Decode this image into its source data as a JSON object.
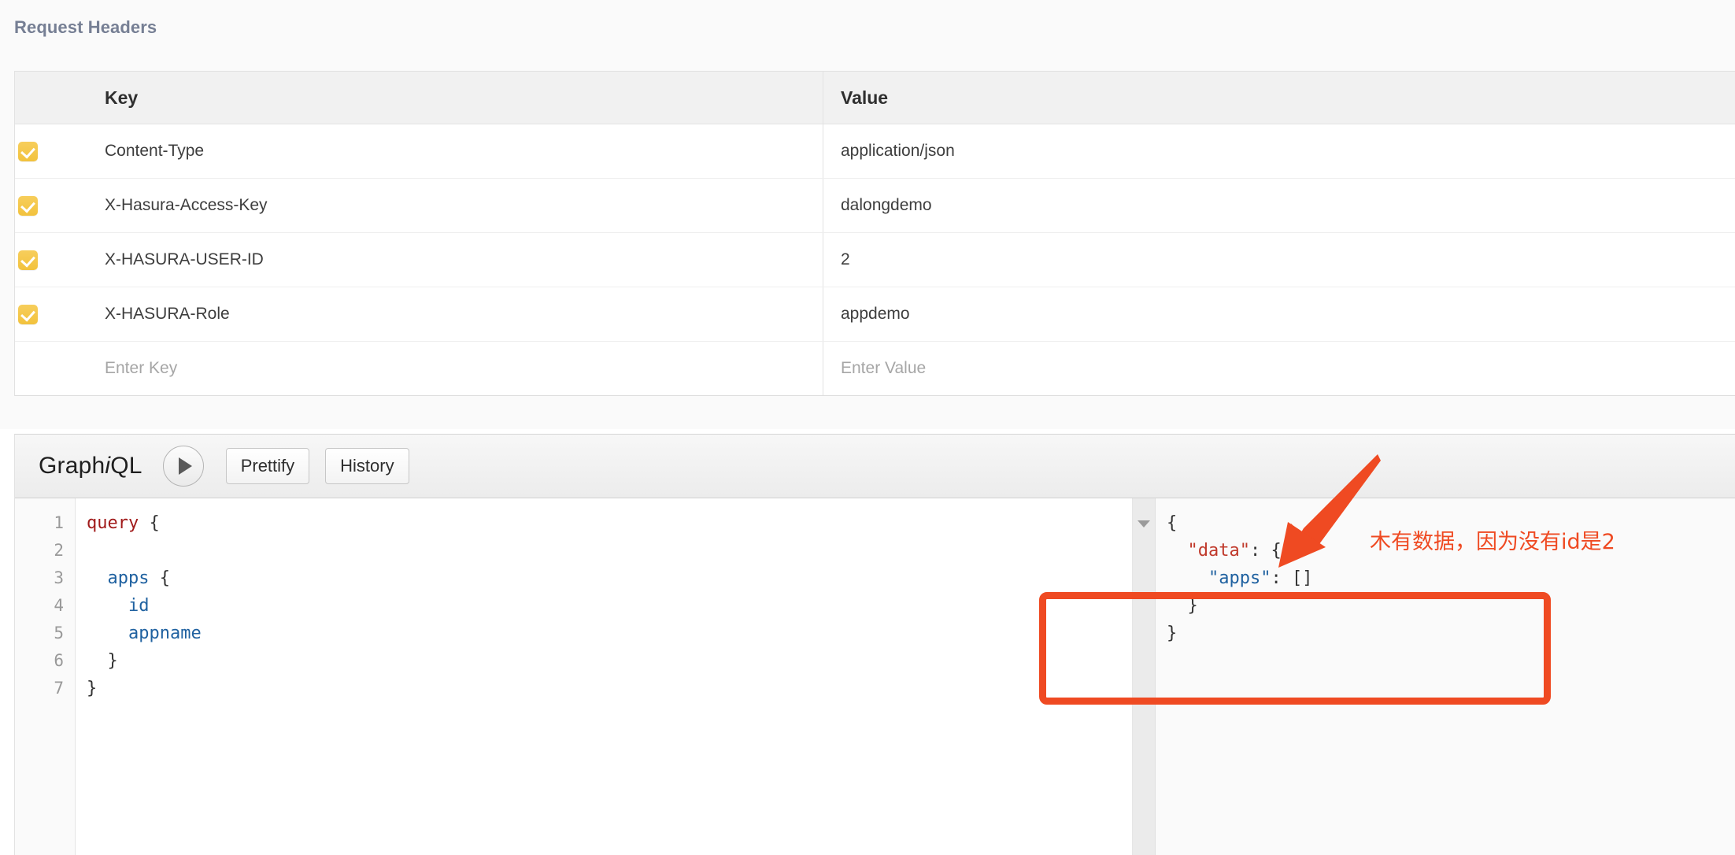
{
  "headers_panel": {
    "title": "Request Headers",
    "columns": {
      "checkbox": "",
      "key": "Key",
      "value": "Value"
    },
    "rows": [
      {
        "checked": true,
        "key": "Content-Type",
        "value": "application/json"
      },
      {
        "checked": true,
        "key": "X-Hasura-Access-Key",
        "value": "dalongdemo"
      },
      {
        "checked": true,
        "key": "X-HASURA-USER-ID",
        "value": "2"
      },
      {
        "checked": true,
        "key": "X-HASURA-Role",
        "value": "appdemo"
      }
    ],
    "new_row": {
      "key_placeholder": "Enter Key",
      "value_placeholder": "Enter Value"
    }
  },
  "graphiql": {
    "logo_prefix": "Graph",
    "logo_italic": "i",
    "logo_suffix": "QL",
    "execute_button_label": "",
    "prettify_label": "Prettify",
    "history_label": "History",
    "query_editor": {
      "line_numbers": [
        "1",
        "2",
        "3",
        "4",
        "5",
        "6",
        "7"
      ],
      "lines": [
        {
          "tokens": [
            {
              "t": "query",
              "c": "kw"
            },
            {
              "t": " ",
              "c": "pun"
            },
            {
              "t": "{",
              "c": "pun"
            }
          ]
        },
        {
          "tokens": [
            {
              "t": "",
              "c": "pun"
            }
          ]
        },
        {
          "tokens": [
            {
              "t": "  ",
              "c": "pun"
            },
            {
              "t": "apps",
              "c": "fld"
            },
            {
              "t": " {",
              "c": "pun"
            }
          ]
        },
        {
          "tokens": [
            {
              "t": "    ",
              "c": "pun"
            },
            {
              "t": "id",
              "c": "fld"
            }
          ]
        },
        {
          "tokens": [
            {
              "t": "    ",
              "c": "pun"
            },
            {
              "t": "appname",
              "c": "fld"
            }
          ]
        },
        {
          "tokens": [
            {
              "t": "  }",
              "c": "pun"
            }
          ]
        },
        {
          "tokens": [
            {
              "t": "}",
              "c": "pun"
            }
          ]
        }
      ]
    },
    "result_pane": {
      "lines": [
        {
          "tokens": [
            {
              "t": "{",
              "c": "pun"
            }
          ]
        },
        {
          "tokens": [
            {
              "t": "  ",
              "c": "pun"
            },
            {
              "t": "\"data\"",
              "c": "rkey"
            },
            {
              "t": ": {",
              "c": "pun"
            }
          ]
        },
        {
          "tokens": [
            {
              "t": "    ",
              "c": "pun"
            },
            {
              "t": "\"apps\"",
              "c": "rkey2"
            },
            {
              "t": ": []",
              "c": "pun"
            }
          ]
        },
        {
          "tokens": [
            {
              "t": "  }",
              "c": "pun"
            }
          ]
        },
        {
          "tokens": [
            {
              "t": "}",
              "c": "pun"
            }
          ]
        }
      ]
    }
  },
  "annotations": {
    "note_text": "木有数据，因为没有id是2",
    "accent_color": "#ef4a22",
    "highlight_rect": true,
    "arrow": true
  },
  "colors": {
    "checkbox": "#f2c23d",
    "title": "#767f94",
    "keyword": "#a11b1b",
    "field": "#1f61a0",
    "json_key": "#c0392b"
  }
}
